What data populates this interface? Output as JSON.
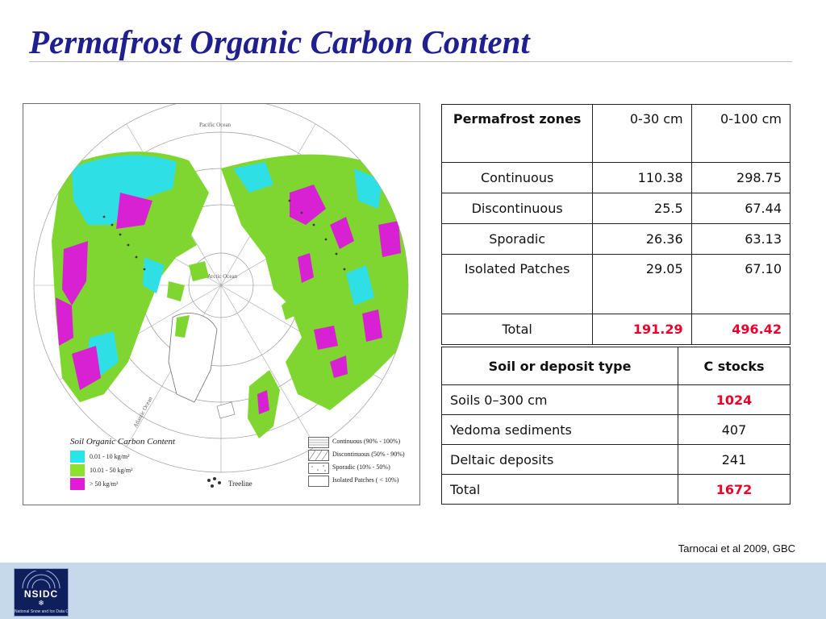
{
  "slide": {
    "title": "Permafrost Organic Carbon Content",
    "citation": "Tarnocai et al 2009, GBC"
  },
  "map": {
    "legend_title": "Soil Organic Carbon Content",
    "carbon_classes": [
      {
        "label": "0.01 - 10 kg/m²",
        "color": "#26e6ea"
      },
      {
        "label": "10.01 - 50 kg/m²",
        "color": "#8be22c"
      },
      {
        "label": "> 50 kg/m²",
        "color": "#e21ad9"
      }
    ],
    "permafrost_classes": [
      {
        "label": "Continuous (90% - 100%)"
      },
      {
        "label": "Discontinuous (50% - 90%)"
      },
      {
        "label": "Sporadic (10% - 50%)"
      },
      {
        "label": "Isolated Patches ( < 10%)"
      }
    ],
    "treeline_label": "Treeline",
    "ocean_labels": {
      "pacific": "Pacific Ocean",
      "arctic": "Arctic Ocean",
      "atlantic": "Atlantic Ocean"
    }
  },
  "zones_table": {
    "header": {
      "zone": "Permafrost zones",
      "c1": "0-30 cm",
      "c2": "0-100 cm"
    },
    "rows": [
      {
        "zone": "Continuous",
        "c1": "110.38",
        "c2": "298.75"
      },
      {
        "zone": "Discontinuous",
        "c1": "25.5",
        "c2": "67.44"
      },
      {
        "zone": "Sporadic",
        "c1": "26.36",
        "c2": "63.13"
      },
      {
        "zone": "Isolated Patches",
        "c1": "29.05",
        "c2": "67.10"
      }
    ],
    "total": {
      "zone": "Total",
      "c1": "191.29",
      "c2": "496.42"
    }
  },
  "stocks_table": {
    "header": {
      "type": "Soil or deposit type",
      "value": "C stocks"
    },
    "rows": [
      {
        "type": "Soils 0–300 cm",
        "value": "1024"
      },
      {
        "type": "Yedoma sediments",
        "value": "407"
      },
      {
        "type": "Deltaic deposits",
        "value": "241"
      }
    ],
    "total": {
      "type": "Total",
      "value": "1672"
    }
  },
  "footer": {
    "logo_text": "NSIDC",
    "logo_subtext": "National Snow and Ice Data Center",
    "background_color": "#c5d9ea"
  },
  "colors": {
    "title": "#1f1f8f",
    "total_highlight": "#e8002a"
  }
}
